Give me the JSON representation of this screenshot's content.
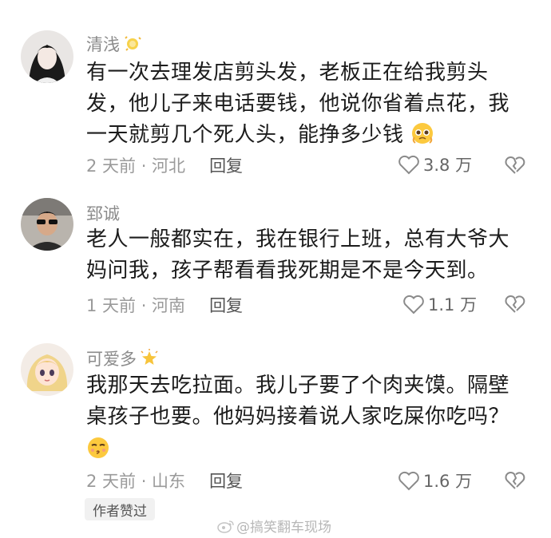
{
  "comments": [
    {
      "username": "清浅",
      "badge_icon": "fairy-dust-emoji",
      "text": "有一次去理发店剪头发，老板正在给我剪头发，他儿子来电话要钱，他说你省着点花，我一天就剪几个死人头，能挣多少钱",
      "text_emoji": "pleading-face-emoji",
      "time_location": "2 天前 · 河北",
      "reply_label": "回复",
      "likes": "3.8 万"
    },
    {
      "username": "郅诚",
      "text": "老人一般都实在，我在银行上班，总有大爷大妈问我，孩子帮看看我死期是不是今天到。",
      "time_location": "1 天前 · 河南",
      "reply_label": "回复",
      "likes": "1.1 万"
    },
    {
      "username": "可爱多",
      "badge_icon": "glowing-star-emoji",
      "text": "我那天去吃拉面。我儿子要了个肉夹馍。隔壁桌孩子也要。他妈妈接着说人家吃屎你吃吗？",
      "text_emoji": "unamused-kiss-face-emoji",
      "time_location": "2 天前 · 山东",
      "reply_label": "回复",
      "likes": "1.6 万",
      "author_tag": "作者赞过"
    }
  ],
  "watermark": "@搞笑翻车现场"
}
